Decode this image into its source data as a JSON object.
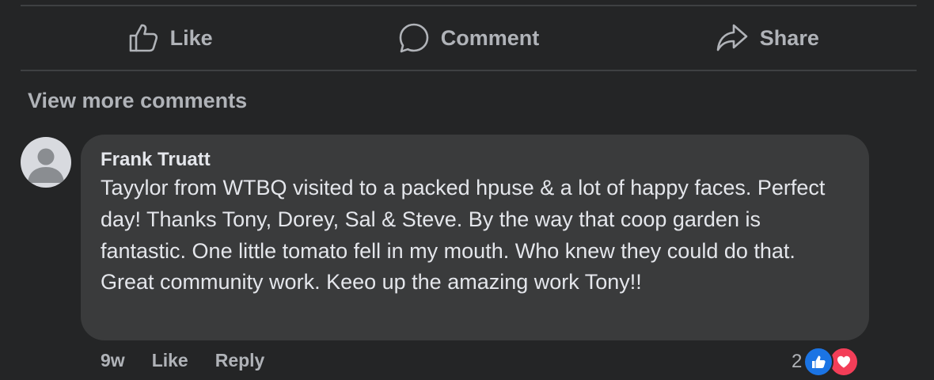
{
  "actions": {
    "like_label": "Like",
    "comment_label": "Comment",
    "share_label": "Share"
  },
  "comments_section": {
    "view_more_label": "View more comments"
  },
  "comment": {
    "author": "Frank Truatt",
    "text": "Tayylor from WTBQ visited to a packed hpuse & a lot of happy faces. Perfect day! Thanks Tony, Dorey, Sal & Steve. By the way that coop garden is fantastic. One little tomato fell in my mouth. Who knew they could do that. Great community work. Keeo up the amazing work Tony!!",
    "time": "9w",
    "like_label": "Like",
    "reply_label": "Reply",
    "reaction_count": "2",
    "reaction_icons": [
      "like-reaction-icon",
      "love-reaction-icon"
    ]
  },
  "colors": {
    "background": "#242526",
    "bubble": "#3a3b3c",
    "primary_text": "#e4e6eb",
    "secondary_text": "#b0b3b8",
    "like_blue": "#1b74e4",
    "love_red": "#f33e58"
  }
}
